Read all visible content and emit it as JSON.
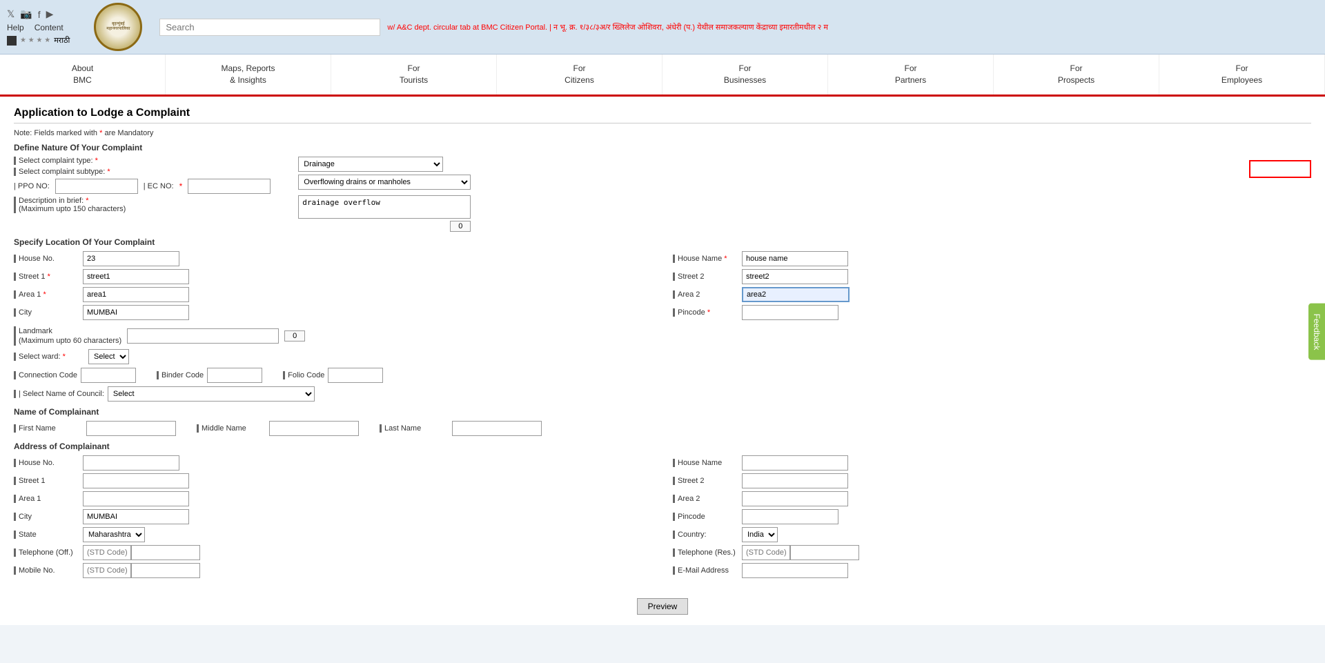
{
  "header": {
    "social_icons": [
      "twitter",
      "instagram",
      "facebook",
      "youtube"
    ],
    "logo_text": "बृहन्मुंबई महानगरपालिका",
    "search_placeholder": "Search",
    "marquee": "w/ A&C dept. circular tab at BMC Citizen Portal. | न भू. क्र. १/३८/३अ/र ख्लिलेज ओशिवरा, अंधेरी (प.) येथील समाजकल्याण केंद्राच्या इमारतीमधील २ म",
    "help_label": "Help",
    "content_label": "Content",
    "marathi_label": "मराठी"
  },
  "nav": {
    "items": [
      {
        "label": "About\nBMC"
      },
      {
        "label": "Maps, Reports\n& Insights"
      },
      {
        "label": "For\nTourists"
      },
      {
        "label": "For\nCitizens"
      },
      {
        "label": "For\nBusinesses"
      },
      {
        "label": "For\nPartners"
      },
      {
        "label": "For\nProspects"
      },
      {
        "label": "For\nEmployees"
      }
    ]
  },
  "page": {
    "title": "Application to Lodge a Complaint",
    "note": "Note: Fields marked with * are Mandatory",
    "define_nature_label": "Define Nature Of Your Complaint",
    "complaint_type_label": "| Select complaint type:",
    "complaint_subtype_label": "| Select complaint subtype:",
    "complaint_type_value": "Drainage",
    "complaint_subtype_value": "Overflowing drains or manholes",
    "ppo_label": "| PPO NO:",
    "ec_label": "| EC NO:",
    "description_label": "| Description in brief:",
    "description_note": "(Maximum upto 150 characters)",
    "description_value": "drainage overflow",
    "char_count_desc": "0",
    "specify_location_label": "Specify Location Of Your Complaint",
    "house_no_label": "| House No.",
    "house_no_value": "23",
    "street1_label": "| Street 1",
    "street1_value": "street1",
    "area1_label": "| Area 1",
    "area1_value": "area1",
    "city_label": "| City",
    "city_value": "MUMBAI",
    "landmark_label": "| Landmark\n(Maximum upto 60 characters)",
    "char_count_landmark": "0",
    "select_ward_label": "| Select ward:",
    "select_ward_value": "Select",
    "connection_code_label": "| Connection Code",
    "binder_code_label": "| Binder Code",
    "folio_code_label": "| Folio Code",
    "select_council_label": "| Select Name of Council:",
    "select_council_value": "Select",
    "house_name_label": "| House Name",
    "house_name_value": "house name",
    "street2_label": "| Street 2",
    "street2_value": "street2",
    "area2_label": "| Area 2",
    "area2_value": "area2",
    "pincode_label": "| Pincode",
    "name_complainant_label": "Name of Complainant",
    "first_name_label": "| First Name",
    "middle_name_label": "| Middle Name",
    "last_name_label": "| Last Name",
    "address_complainant_label": "Address of Complainant",
    "addr_house_no_label": "| House No.",
    "addr_street1_label": "| Street 1",
    "addr_area1_label": "| Area 1",
    "addr_city_label": "| City",
    "addr_city_value": "MUMBAI",
    "addr_state_label": "| State",
    "addr_state_value": "Maharashtra",
    "addr_telephone_off_label": "| Telephone (Off.)",
    "addr_mobile_label": "| Mobile No.",
    "addr_house_name_label": "| House Name",
    "addr_street2_label": "| Street 2",
    "addr_area2_label": "| Area 2",
    "addr_pincode_label": "| Pincode",
    "addr_country_label": "| Country:",
    "addr_country_value": "India",
    "addr_telephone_res_label": "| Telephone (Res.)",
    "addr_email_label": "| E-Mail Address",
    "std_code_placeholder": "(STD Code)",
    "preview_button": "Preview",
    "feedback_label": "Feedback"
  }
}
